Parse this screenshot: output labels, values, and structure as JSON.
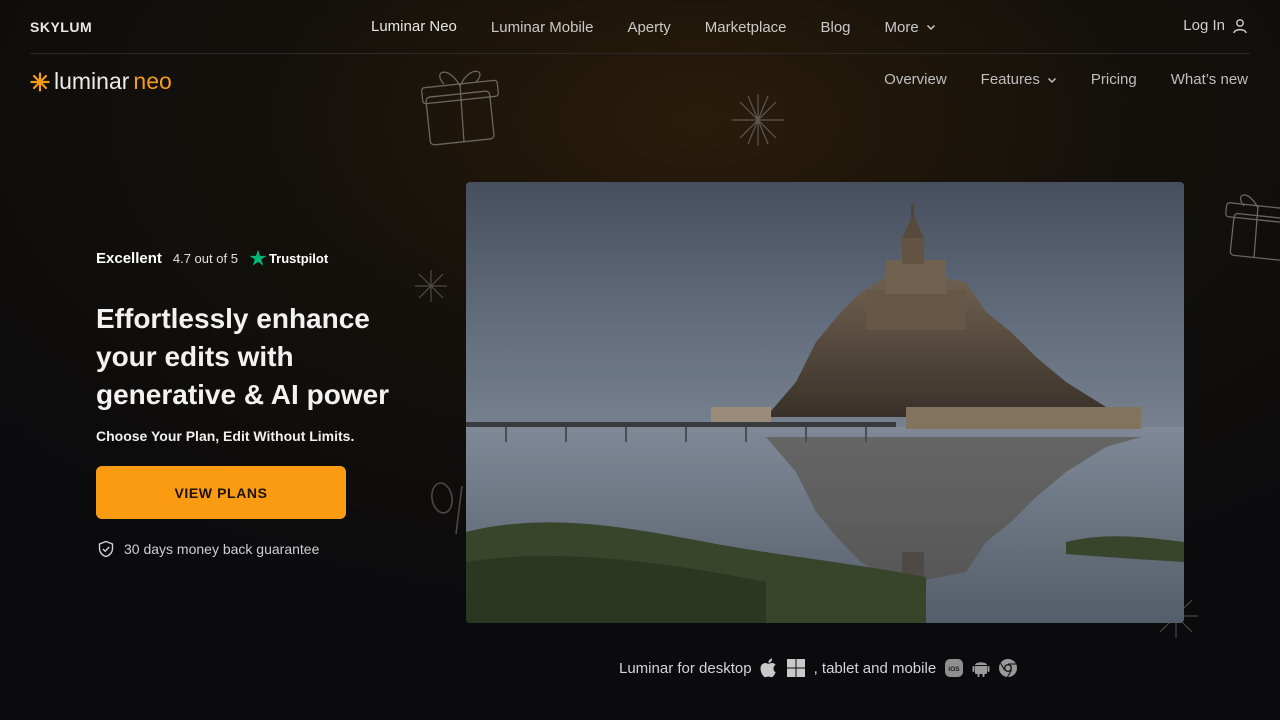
{
  "topbar": {
    "brand": "SKYLUM",
    "nav": [
      {
        "label": "Luminar Neo",
        "active": true
      },
      {
        "label": "Luminar Mobile"
      },
      {
        "label": "Aperty"
      },
      {
        "label": "Marketplace"
      },
      {
        "label": "Blog"
      },
      {
        "label": "More"
      }
    ],
    "login": "Log In"
  },
  "subbar": {
    "logo_part1": "luminar",
    "logo_part2": "neo",
    "nav": [
      {
        "label": "Overview"
      },
      {
        "label": "Features"
      },
      {
        "label": "Pricing"
      },
      {
        "label": "What’s new"
      }
    ]
  },
  "hero": {
    "rating_word": "Excellent",
    "rating_score": "4.7 out of 5",
    "trustpilot": "Trustpilot",
    "headline": "Effortlessly enhance your edits with generative & AI power",
    "subheadline": "Choose Your Plan, Edit Without Limits.",
    "cta_label": "VIEW PLANS",
    "guarantee": "30 days money back guarantee",
    "image_alt": "Mont-Saint-Michel reflected in water"
  },
  "platforms": {
    "desktop_label": "Luminar for desktop",
    "mobile_label": ", tablet and mobile",
    "icons": [
      "apple-icon",
      "windows-icon",
      "ios-icon",
      "android-icon",
      "chrome-icon"
    ]
  },
  "colors": {
    "accent": "#fb9b12",
    "trustpilot_green": "#00b67a"
  }
}
